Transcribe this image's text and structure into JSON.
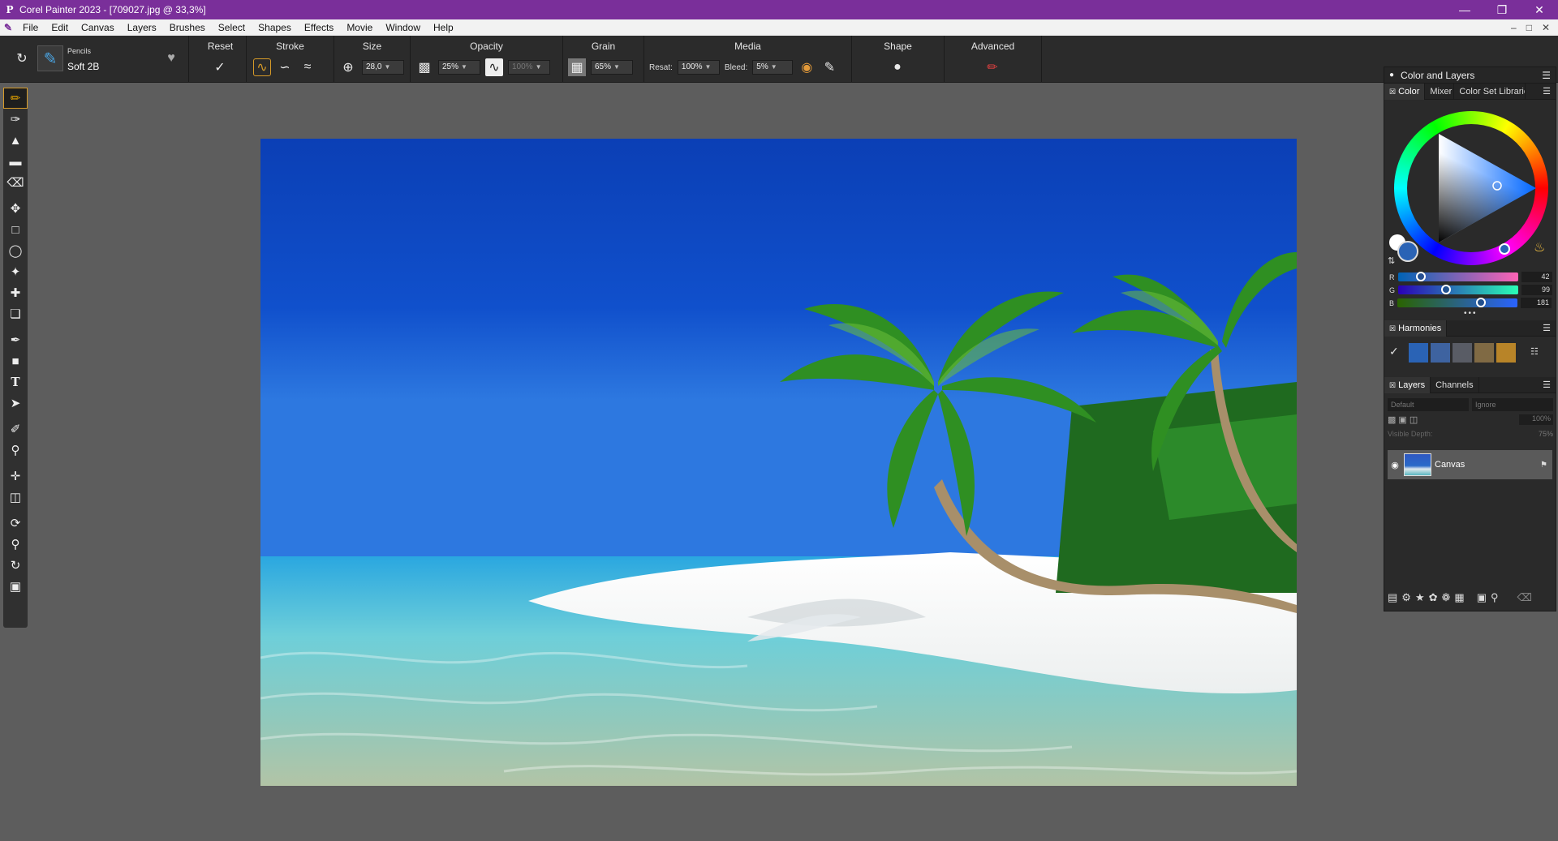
{
  "window": {
    "title": "Corel Painter 2023 - [709027.jpg @ 33,3%]",
    "logo_glyph": "P",
    "minimize": "—",
    "restore": "❐",
    "close": "✕"
  },
  "menubar": {
    "items": [
      "File",
      "Edit",
      "Canvas",
      "Layers",
      "Brushes",
      "Select",
      "Shapes",
      "Effects",
      "Movie",
      "Window",
      "Help"
    ],
    "doc_controls": [
      "–",
      "□",
      "✕"
    ]
  },
  "propbar": {
    "brush_category": "Pencils",
    "brush_variant": "Soft 2B",
    "sections": {
      "reset": "Reset",
      "stroke": "Stroke",
      "size": "Size",
      "opacity": "Opacity",
      "grain": "Grain",
      "media": "Media",
      "shape": "Shape",
      "advanced": "Advanced"
    },
    "size_value": "28,0",
    "opacity_value": "25%",
    "opacity_secondary": "100%",
    "grain_value": "65%",
    "resat_label": "Resat:",
    "resat_value": "100%",
    "bleed_label": "Bleed:",
    "bleed_value": "5%"
  },
  "toolbox": {
    "tools": [
      "brush",
      "dropper",
      "paint-bucket",
      "gradient",
      "eraser",
      "transform",
      "rect-select",
      "lasso",
      "magic-wand",
      "select-adjuster",
      "crop",
      "pen",
      "shape",
      "text",
      "shape-selection",
      "cloner",
      "rubber-stamp",
      "blend",
      "perspective",
      "mirror",
      "magnifier",
      "rotate",
      "navigator"
    ]
  },
  "panel": {
    "title": "Color and Layers",
    "color_tabs": [
      "Color",
      "Mixer",
      "Color Set Libraries"
    ],
    "rgb": {
      "R": "42",
      "G": "99",
      "B": "181"
    },
    "main_color": "#2a63b5",
    "harmonies_title": "Harmonies",
    "harmony_colors": [
      "#2a63b5",
      "#3e63a0",
      "#595c65",
      "#806a44",
      "#b88428"
    ],
    "layers_tabs": [
      "Layers",
      "Channels"
    ],
    "composite_method": "Default",
    "preserve_mode": "Ignore",
    "opacity": "100%",
    "visible_depth_label": "Visible Depth:",
    "visible_depth": "75%",
    "layer_name": "Canvas"
  }
}
